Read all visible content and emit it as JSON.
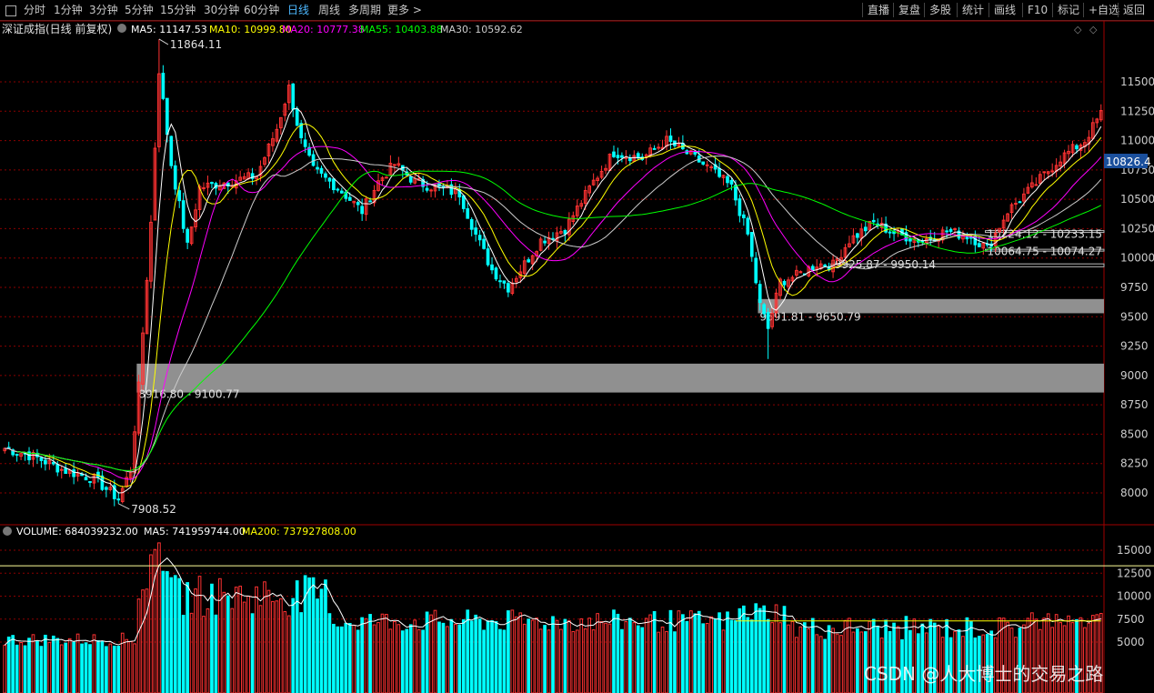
{
  "toolbar": {
    "periods": [
      "分时",
      "1分钟",
      "3分钟",
      "5分钟",
      "15分钟",
      "30分钟",
      "60分钟",
      "日线",
      "周线",
      "多周期",
      "更多 >"
    ],
    "active": "日线",
    "right_buttons": [
      "直播",
      "复盘",
      "多股",
      "统计",
      "画线",
      "F10",
      "标记",
      "+自选",
      "返回"
    ]
  },
  "price_panel": {
    "title": "深证成指(日线 前复权)",
    "ma_labels": [
      {
        "label": "MA5: 11147.53",
        "color": "#ffffff"
      },
      {
        "label": "MA10: 10999.80",
        "color": "#ffff00"
      },
      {
        "label": "MA20: 10777.38",
        "color": "#ff00ff"
      },
      {
        "label": "MA55: 10403.88",
        "color": "#00ff00"
      },
      {
        "label": "MA30: 10592.62",
        "color": "#cccccc"
      }
    ],
    "current_price_label": "10826.4",
    "high_label": "11864.11",
    "low_label": "7908.52",
    "zones": [
      {
        "label": "8916.80 - 9100.77",
        "low": 8916.8,
        "high": 9100.77,
        "start_index": 33
      },
      {
        "label": "9591.81 - 9650.79",
        "low": 9591.81,
        "high": 9650.79,
        "start_index": 186
      },
      {
        "label": "9925.87 - 9950.14",
        "low": 9925.87,
        "high": 9950.14,
        "start_index": 204
      },
      {
        "label": "10064.75 - 10074.27",
        "low": 10064.75,
        "high": 10074.27,
        "start_index": 242
      },
      {
        "label": "10224.12 - 10233.15",
        "low": 10224.12,
        "high": 10233.15,
        "start_index": 242
      }
    ]
  },
  "volume_panel": {
    "labels": [
      {
        "label": "VOLUME: 684039232.00",
        "color": "#ffffff"
      },
      {
        "label": "MA5: 741959744.00",
        "color": "#ffffff"
      },
      {
        "label": "MA200: 737927808.00",
        "color": "#ffff00"
      }
    ]
  },
  "watermark": "CSDN @人大博士的交易之路",
  "colors": {
    "up": "#ff3232",
    "down": "#00ffff",
    "ma5": "#ffffff",
    "ma10": "#ffff00",
    "ma20": "#ff00ff",
    "ma55": "#00ff00",
    "ma30": "#cccccc",
    "grid": "#8b0000",
    "zone": "#909090"
  },
  "chart_data": {
    "type": "candlestick",
    "title": "深证成指(日线 前复权)",
    "y_axis_ticks": [
      8000,
      8250,
      8500,
      8750,
      9000,
      9250,
      9500,
      9750,
      10000,
      10250,
      10500,
      10750,
      11000,
      11250,
      11500
    ],
    "volume_axis_ticks": [
      5000,
      7500,
      10000,
      12500,
      15000
    ],
    "price_ylim": [
      7800,
      12100
    ],
    "volume_ylim": [
      3500,
      16000
    ],
    "key_points": [
      {
        "index": 0,
        "close": 8380
      },
      {
        "index": 8,
        "close": 8300
      },
      {
        "index": 14,
        "close": 8200
      },
      {
        "index": 22,
        "close": 8120
      },
      {
        "index": 28,
        "close": 7950
      },
      {
        "index": 31,
        "close": 8200
      },
      {
        "index": 33,
        "close": 8900
      },
      {
        "index": 36,
        "close": 10300
      },
      {
        "index": 38,
        "close": 11600
      },
      {
        "index": 41,
        "close": 10800
      },
      {
        "index": 45,
        "close": 10100
      },
      {
        "index": 48,
        "close": 10600
      },
      {
        "index": 55,
        "close": 10650
      },
      {
        "index": 62,
        "close": 10700
      },
      {
        "index": 67,
        "close": 11100
      },
      {
        "index": 70,
        "close": 11450
      },
      {
        "index": 73,
        "close": 11000
      },
      {
        "index": 76,
        "close": 10750
      },
      {
        "index": 82,
        "close": 10600
      },
      {
        "index": 88,
        "close": 10400
      },
      {
        "index": 92,
        "close": 10650
      },
      {
        "index": 96,
        "close": 10800
      },
      {
        "index": 101,
        "close": 10650
      },
      {
        "index": 106,
        "close": 10600
      },
      {
        "index": 112,
        "close": 10550
      },
      {
        "index": 116,
        "close": 10200
      },
      {
        "index": 120,
        "close": 9900
      },
      {
        "index": 124,
        "close": 9750
      },
      {
        "index": 128,
        "close": 9950
      },
      {
        "index": 132,
        "close": 10150
      },
      {
        "index": 138,
        "close": 10250
      },
      {
        "index": 145,
        "close": 10650
      },
      {
        "index": 150,
        "close": 10900
      },
      {
        "index": 157,
        "close": 10850
      },
      {
        "index": 163,
        "close": 11000
      },
      {
        "index": 170,
        "close": 10850
      },
      {
        "index": 174,
        "close": 10750
      },
      {
        "index": 179,
        "close": 10600
      },
      {
        "index": 183,
        "close": 10200
      },
      {
        "index": 186,
        "close": 9600
      },
      {
        "index": 188,
        "close": 9400
      },
      {
        "index": 191,
        "close": 9800
      },
      {
        "index": 195,
        "close": 9850
      },
      {
        "index": 200,
        "close": 9950
      },
      {
        "index": 204,
        "close": 9940
      },
      {
        "index": 208,
        "close": 10150
      },
      {
        "index": 214,
        "close": 10300
      },
      {
        "index": 220,
        "close": 10200
      },
      {
        "index": 226,
        "close": 10150
      },
      {
        "index": 232,
        "close": 10230
      },
      {
        "index": 238,
        "close": 10180
      },
      {
        "index": 242,
        "close": 10080
      },
      {
        "index": 247,
        "close": 10400
      },
      {
        "index": 253,
        "close": 10600
      },
      {
        "index": 260,
        "close": 10850
      },
      {
        "index": 266,
        "close": 11000
      },
      {
        "index": 270,
        "close": 11230
      }
    ],
    "series": [
      {
        "name": "MA5",
        "last": 11147.53
      },
      {
        "name": "MA10",
        "last": 10999.8
      },
      {
        "name": "MA20",
        "last": 10777.38
      },
      {
        "name": "MA55",
        "last": 10403.88
      },
      {
        "name": "MA30",
        "last": 10592.62
      }
    ],
    "volume_last": 684039232.0,
    "volume_ma5": 741959744.0,
    "volume_ma200": 737927808.0,
    "grid": true
  }
}
